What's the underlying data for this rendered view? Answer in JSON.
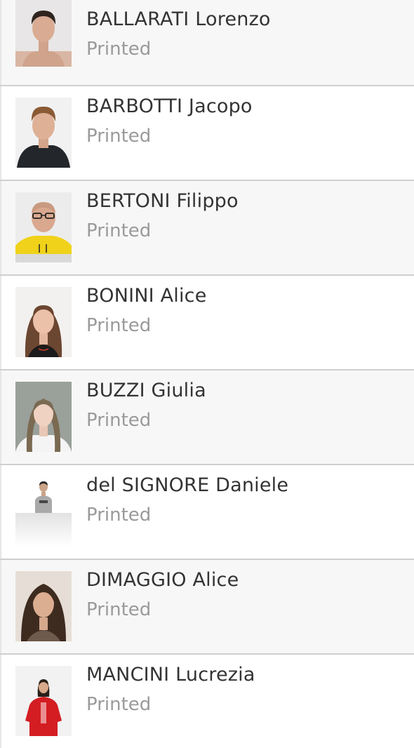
{
  "list": {
    "items": [
      {
        "name": "BALLARATI Lorenzo",
        "status": "Printed",
        "photo": "portrait-photo"
      },
      {
        "name": "BARBOTTI Jacopo",
        "status": "Printed",
        "photo": "portrait-photo"
      },
      {
        "name": "BERTONI Filippo",
        "status": "Printed",
        "photo": "portrait-photo"
      },
      {
        "name": "BONINI Alice",
        "status": "Printed",
        "photo": "portrait-photo"
      },
      {
        "name": "BUZZI Giulia",
        "status": "Printed",
        "photo": "portrait-photo"
      },
      {
        "name": "del SIGNORE Daniele",
        "status": "Printed",
        "photo": "portrait-photo"
      },
      {
        "name": "DIMAGGIO Alice",
        "status": "Printed",
        "photo": "portrait-photo"
      },
      {
        "name": "MANCINI Lucrezia",
        "status": "Printed",
        "photo": "portrait-photo"
      }
    ]
  },
  "colors": {
    "row_shaded": "#f7f7f7",
    "row_plain": "#ffffff",
    "divider": "#cfcfcf",
    "name_text": "#333333",
    "status_text": "#9a9a9a"
  }
}
